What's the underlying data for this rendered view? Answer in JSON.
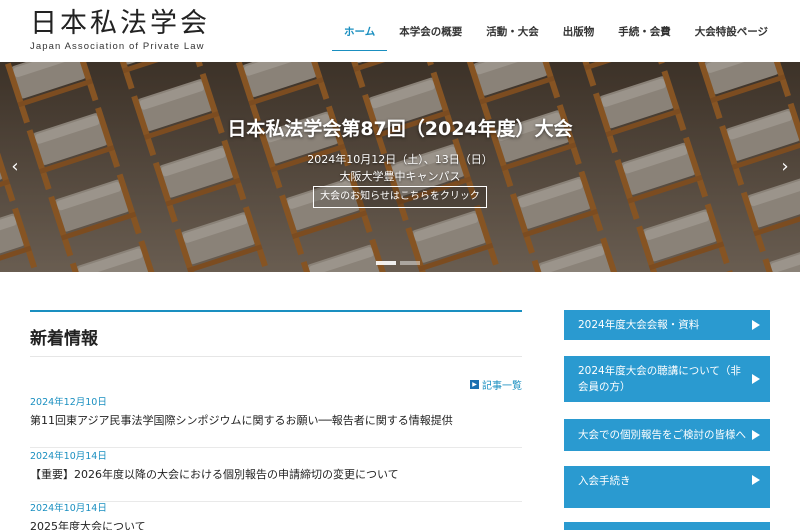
{
  "site": {
    "title": "日本私法学会",
    "subtitle": "Japan Association of Private Law"
  },
  "nav": {
    "items": [
      {
        "label": "ホーム",
        "active": true
      },
      {
        "label": "本学会の概要"
      },
      {
        "label": "活動・大会"
      },
      {
        "label": "出版物"
      },
      {
        "label": "手続・会費"
      },
      {
        "label": "大会特設ページ"
      }
    ]
  },
  "hero": {
    "title": "日本私法学会第87回（2024年度）大会",
    "date": "2024年10月12日（土）、13日（日）",
    "venue": "大阪大学豊中キャンパス",
    "button": "大会のお知らせはこちらをクリック",
    "prev_icon": "chevron-left-icon",
    "next_icon": "chevron-right-icon",
    "slide_count": 2,
    "active_slide": 1
  },
  "news": {
    "heading": "新着情報",
    "more_label": "記事一覧",
    "items": [
      {
        "date": "2024年12月10日",
        "text": "第11回東アジア民事法学国際シンポジウムに関するお願い──報告者に関する情報提供"
      },
      {
        "date": "2024年10月14日",
        "text": "【重要】2026年度以降の大会における個別報告の申請締切の変更について"
      },
      {
        "date": "2024年10月14日",
        "text": "2025年度大会について"
      }
    ]
  },
  "sidebar": {
    "buttons": [
      {
        "label": "2024年度大会会報・資料"
      },
      {
        "label": "2024年度大会の聴講について（非会員の方）"
      },
      {
        "label": "大会での個別報告をご検討の皆様へ"
      },
      {
        "label": "入会手続き"
      }
    ]
  },
  "colors": {
    "accent": "#1a8fc0",
    "sidebar_button": "#2a9ad0"
  }
}
